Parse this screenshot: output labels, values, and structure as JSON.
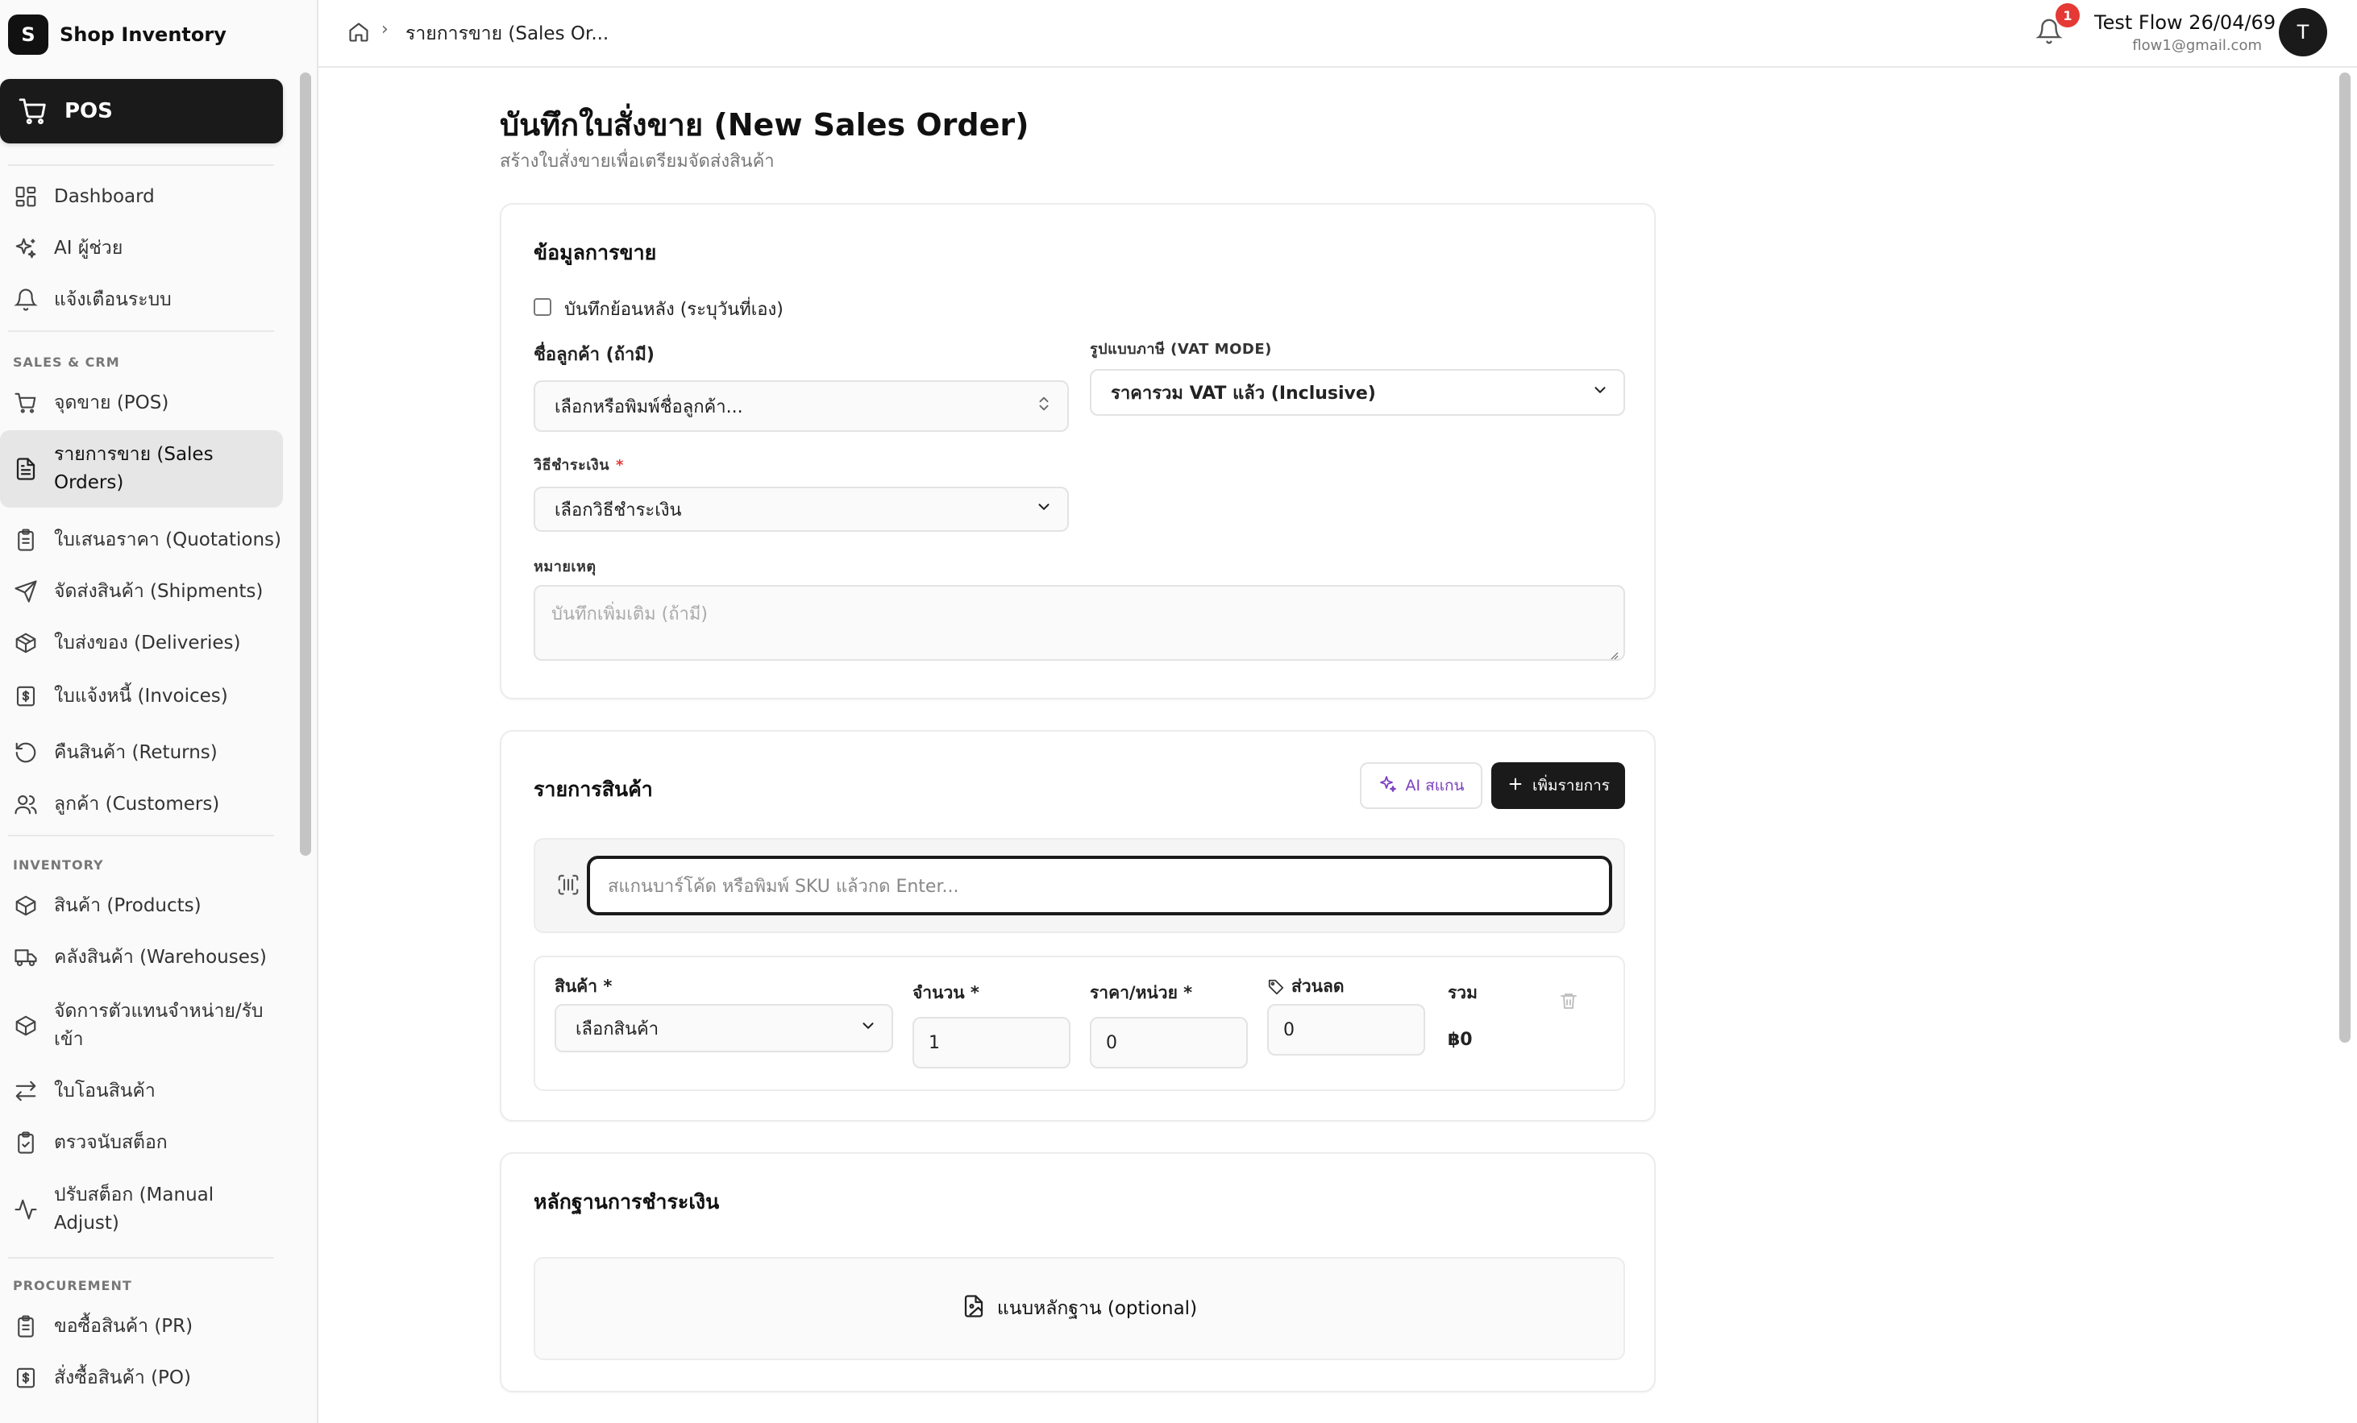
{
  "brand": {
    "logo_letter": "S",
    "name": "Shop Inventory"
  },
  "pos": {
    "label": "POS"
  },
  "sidebar": {
    "top_items": [
      {
        "label": "Dashboard",
        "icon": "dashboard-icon"
      },
      {
        "label": "AI ผู้ช่วย",
        "icon": "sparkles-icon"
      },
      {
        "label": "แจ้งเตือนระบบ",
        "icon": "bell-icon"
      }
    ],
    "sales_label": "SALES & CRM",
    "sales_items": [
      {
        "label": "จุดขาย (POS)",
        "icon": "cart-icon"
      },
      {
        "label": "รายการขาย (Sales Orders)",
        "icon": "document-icon",
        "active": true
      },
      {
        "label": "ใบเสนอราคา (Quotations)",
        "icon": "clipboard-icon"
      },
      {
        "label": "จัดส่งสินค้า (Shipments)",
        "icon": "send-icon"
      },
      {
        "label": "ใบส่งของ (Deliveries)",
        "icon": "package-icon"
      },
      {
        "label": "ใบแจ้งหนี้ (Invoices)",
        "icon": "invoice-icon"
      },
      {
        "label": "คืนสินค้า (Returns)",
        "icon": "rotate-icon"
      },
      {
        "label": "ลูกค้า (Customers)",
        "icon": "users-icon"
      }
    ],
    "inventory_label": "INVENTORY",
    "inventory_items": [
      {
        "label": "สินค้า (Products)",
        "icon": "box-icon"
      },
      {
        "label": "คลังสินค้า (Warehouses)",
        "icon": "truck-icon"
      },
      {
        "label": "จัดการตัวแทนจำหน่าย/รับเข้า",
        "icon": "box-icon"
      },
      {
        "label": "ใบโอนสินค้า",
        "icon": "transfer-icon"
      },
      {
        "label": "ตรวจนับสต็อก",
        "icon": "clipboard-check-icon"
      },
      {
        "label": "ปรับสต็อก (Manual Adjust)",
        "icon": "activity-icon"
      }
    ],
    "procurement_label": "PROCUREMENT",
    "procurement_items": [
      {
        "label": "ขอซื้อสินค้า (PR)",
        "icon": "clipboard-icon"
      },
      {
        "label": "สั่งซื้อสินค้า (PO)",
        "icon": "invoice-icon"
      }
    ]
  },
  "header": {
    "breadcrumb": "รายการขาย (Sales Or...",
    "notification_count": "1",
    "user_name": "Test Flow 26/04/69",
    "user_email": "flow1@gmail.com",
    "avatar_letter": "T"
  },
  "page": {
    "title": "บันทึกใบสั่งขาย (New Sales Order)",
    "subtitle": "สร้างใบสั่งขายเพื่อเตรียมจัดส่งสินค้า"
  },
  "sales_info": {
    "title": "ข้อมูลการขาย",
    "backdate_label": "บันทึกย้อนหลัง (ระบุวันที่เอง)",
    "customer_label": "ชื่อลูกค้า (ถ้ามี)",
    "customer_placeholder": "เลือกหรือพิมพ์ชื่อลูกค้า...",
    "vat_label": "รูปแบบภาษี (VAT MODE)",
    "vat_value": "ราคารวม VAT แล้ว (Inclusive)",
    "payment_label": "วิธีชำระเงิน",
    "payment_required": "*",
    "payment_placeholder": "เลือกวิธีชำระเงิน",
    "note_label": "หมายเหตุ",
    "note_placeholder": "บันทึกเพิ่มเติม (ถ้ามี)"
  },
  "items": {
    "title": "รายการสินค้า",
    "ai_scan_label": "AI สแกน",
    "add_label": "เพิ่มรายการ",
    "scan_placeholder": "สแกนบาร์โค้ด หรือพิมพ์ SKU แล้วกด Enter...",
    "row": {
      "product_label": "สินค้า *",
      "product_placeholder": "เลือกสินค้า",
      "qty_label": "จำนวน *",
      "qty_value": "1",
      "price_label": "ราคา/หน่วย *",
      "price_value": "0",
      "discount_label": "ส่วนลด",
      "discount_value": "0",
      "total_label": "รวม",
      "total_value": "฿0"
    }
  },
  "payment_proof": {
    "title": "หลักฐานการชำระเงิน",
    "upload_label": "แนบหลักฐาน (optional)"
  }
}
